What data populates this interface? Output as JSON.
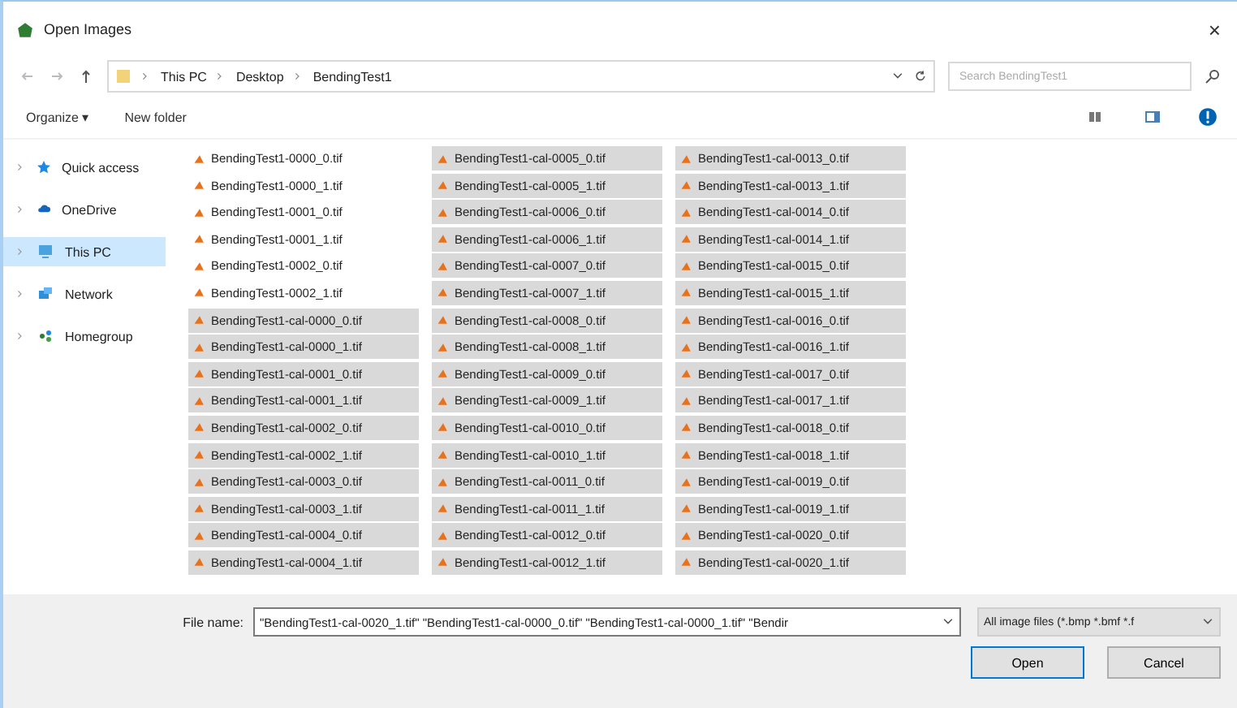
{
  "window": {
    "title": "Open Images",
    "close": "×"
  },
  "address": {
    "path": [
      "This PC",
      "Desktop",
      "BendingTest1"
    ],
    "search_placeholder": "Search BendingTest1"
  },
  "toolbar": {
    "organize": "Organize ▾",
    "new_folder": "New folder"
  },
  "nav": [
    {
      "label": "Quick access",
      "selected": false
    },
    {
      "label": "OneDrive",
      "selected": false
    },
    {
      "label": "This PC",
      "selected": true
    },
    {
      "label": "Network",
      "selected": false
    },
    {
      "label": "Homegroup",
      "selected": false
    }
  ],
  "files": [
    {
      "name": "BendingTest1-0000_0.tif",
      "selected": false
    },
    {
      "name": "BendingTest1-0000_1.tif",
      "selected": false
    },
    {
      "name": "BendingTest1-0001_0.tif",
      "selected": false
    },
    {
      "name": "BendingTest1-0001_1.tif",
      "selected": false
    },
    {
      "name": "BendingTest1-0002_0.tif",
      "selected": false
    },
    {
      "name": "BendingTest1-0002_1.tif",
      "selected": false
    },
    {
      "name": "BendingTest1-cal-0000_0.tif",
      "selected": true
    },
    {
      "name": "BendingTest1-cal-0000_1.tif",
      "selected": true
    },
    {
      "name": "BendingTest1-cal-0001_0.tif",
      "selected": true
    },
    {
      "name": "BendingTest1-cal-0001_1.tif",
      "selected": true
    },
    {
      "name": "BendingTest1-cal-0002_0.tif",
      "selected": true
    },
    {
      "name": "BendingTest1-cal-0002_1.tif",
      "selected": true
    },
    {
      "name": "BendingTest1-cal-0003_0.tif",
      "selected": true
    },
    {
      "name": "BendingTest1-cal-0003_1.tif",
      "selected": true
    },
    {
      "name": "BendingTest1-cal-0004_0.tif",
      "selected": true
    },
    {
      "name": "BendingTest1-cal-0004_1.tif",
      "selected": true
    },
    {
      "name": "BendingTest1-cal-0005_0.tif",
      "selected": true
    },
    {
      "name": "BendingTest1-cal-0005_1.tif",
      "selected": true
    },
    {
      "name": "BendingTest1-cal-0006_0.tif",
      "selected": true
    },
    {
      "name": "BendingTest1-cal-0006_1.tif",
      "selected": true
    },
    {
      "name": "BendingTest1-cal-0007_0.tif",
      "selected": true
    },
    {
      "name": "BendingTest1-cal-0007_1.tif",
      "selected": true
    },
    {
      "name": "BendingTest1-cal-0008_0.tif",
      "selected": true
    },
    {
      "name": "BendingTest1-cal-0008_1.tif",
      "selected": true
    },
    {
      "name": "BendingTest1-cal-0009_0.tif",
      "selected": true
    },
    {
      "name": "BendingTest1-cal-0009_1.tif",
      "selected": true
    },
    {
      "name": "BendingTest1-cal-0010_0.tif",
      "selected": true
    },
    {
      "name": "BendingTest1-cal-0010_1.tif",
      "selected": true
    },
    {
      "name": "BendingTest1-cal-0011_0.tif",
      "selected": true
    },
    {
      "name": "BendingTest1-cal-0011_1.tif",
      "selected": true
    },
    {
      "name": "BendingTest1-cal-0012_0.tif",
      "selected": true
    },
    {
      "name": "BendingTest1-cal-0012_1.tif",
      "selected": true
    },
    {
      "name": "BendingTest1-cal-0013_0.tif",
      "selected": true
    },
    {
      "name": "BendingTest1-cal-0013_1.tif",
      "selected": true
    },
    {
      "name": "BendingTest1-cal-0014_0.tif",
      "selected": true
    },
    {
      "name": "BendingTest1-cal-0014_1.tif",
      "selected": true
    },
    {
      "name": "BendingTest1-cal-0015_0.tif",
      "selected": true
    },
    {
      "name": "BendingTest1-cal-0015_1.tif",
      "selected": true
    },
    {
      "name": "BendingTest1-cal-0016_0.tif",
      "selected": true
    },
    {
      "name": "BendingTest1-cal-0016_1.tif",
      "selected": true
    },
    {
      "name": "BendingTest1-cal-0017_0.tif",
      "selected": true
    },
    {
      "name": "BendingTest1-cal-0017_1.tif",
      "selected": true
    },
    {
      "name": "BendingTest1-cal-0018_0.tif",
      "selected": true
    },
    {
      "name": "BendingTest1-cal-0018_1.tif",
      "selected": true
    },
    {
      "name": "BendingTest1-cal-0019_0.tif",
      "selected": true
    },
    {
      "name": "BendingTest1-cal-0019_1.tif",
      "selected": true
    },
    {
      "name": "BendingTest1-cal-0020_0.tif",
      "selected": true
    },
    {
      "name": "BendingTest1-cal-0020_1.tif",
      "selected": true
    }
  ],
  "footer": {
    "file_name_label": "File name:",
    "file_name": "\"BendingTest1-cal-0020_1.tif\" \"BendingTest1-cal-0000_0.tif\" \"BendingTest1-cal-0000_1.tif\" \"Bendir",
    "file_type": "All image files (*.bmp *.bmf *.f",
    "open": "Open",
    "cancel": "Cancel"
  }
}
